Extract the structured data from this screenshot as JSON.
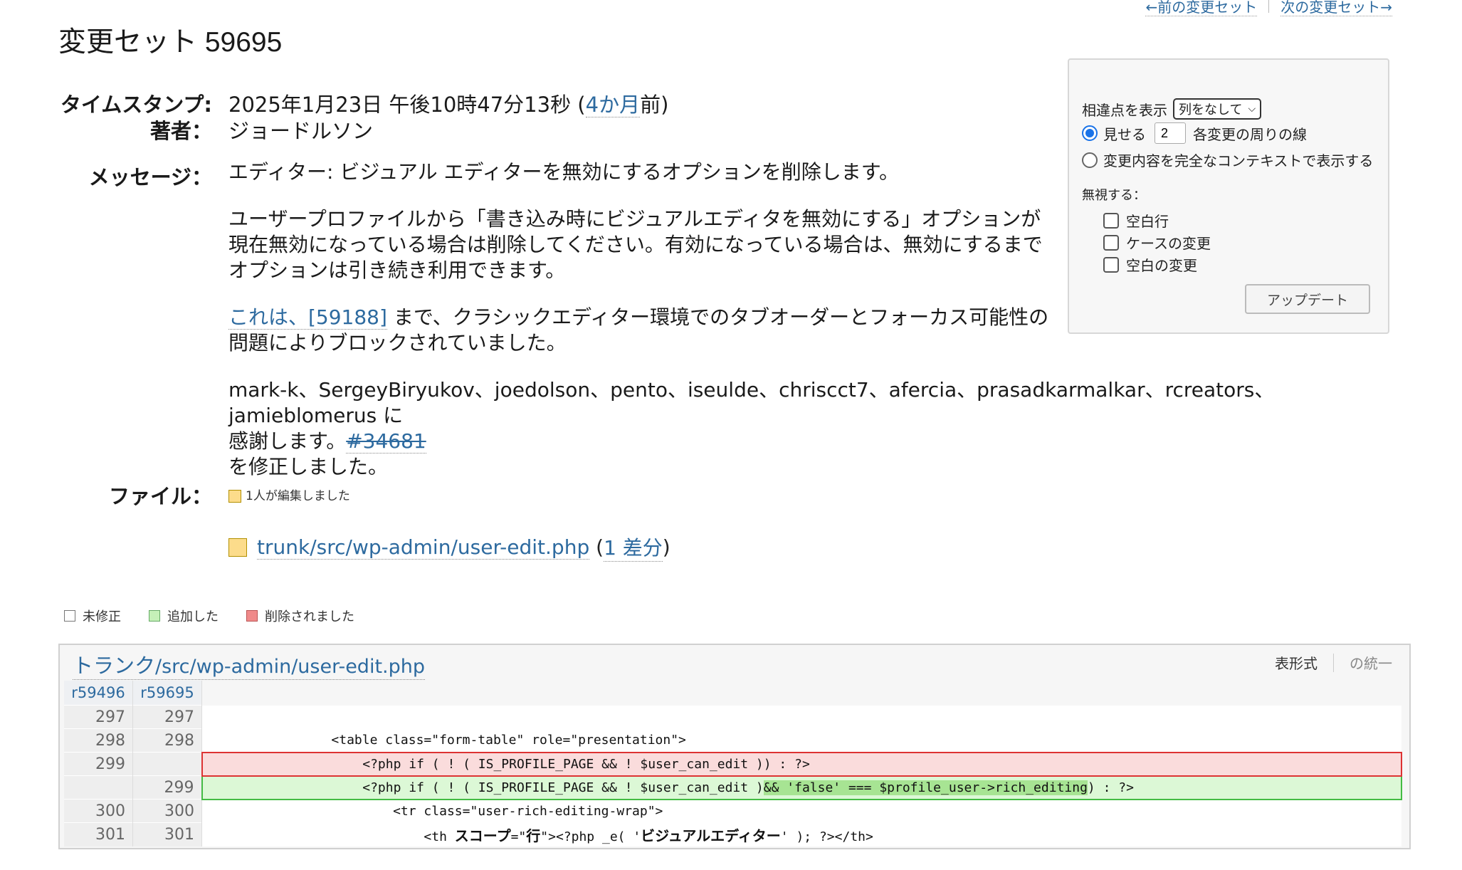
{
  "nav": {
    "prev": "←前の変更セット",
    "next": "次の変更セット→"
  },
  "title": "変更セット 59695",
  "props": {
    "timestamp_label": "タイムスタンプ:",
    "timestamp_value": "2025年1月23日 午後10時47分13秒 (",
    "timestamp_link": "4か月",
    "timestamp_suffix": "前)",
    "author_label": "著者：",
    "author_value": "ジョードルソン",
    "message_label": "メッセージ：",
    "files_label": "ファイル："
  },
  "message": {
    "p1": "エディター: ビジュアル エディターを無効にするオプションを削除します。",
    "p2_l1": "ユーザープロファイルから「書き込み時にビジュアルエディタを無効にする」オプションが",
    "p2_l2": "現在無効になっている場合は削除してください。有効になっている場合は、無効にするまで",
    "p2_l3": "オプションは引き続き利用できます。",
    "p3_link1": "これは、[59188]",
    "p3_text1": " まで、クラシックエディター環境でのタブオーダーとフォーカス可能性の",
    "p3_l2": "問題によりブロックされていました。",
    "p4_l1": "mark-k、SergeyBiryukov、joedolson、pento、iseulde、chrisсct7、afercia、prasadkarmalkar、rcreators、jamieblomerus に",
    "p4_l2a": "感謝します。",
    "p4_ticket": "#34681",
    "p4_l3": "を修正しました。"
  },
  "files": {
    "legend_edited": "1人が編集しました",
    "file_link": "trunk/src/wp-admin/user-edit.php",
    "open_paren": " (",
    "diff_link": "1 差分",
    "close_paren": ")"
  },
  "diff_options": {
    "show_diff_label": "相違点を表示",
    "show_diff_select": "列をなして",
    "show_label": "見せる",
    "lines_value": "2",
    "lines_suffix": "各変更の周りの線",
    "full_context": "変更内容を完全なコンテキストで表示する",
    "ignore_label": "無視する：",
    "ignore_blank": "空白行",
    "ignore_case": "ケースの変更",
    "ignore_whitespace": "空白の変更",
    "update_button": "アップデート"
  },
  "legend": {
    "unmodified": "未修正",
    "added": "追加した",
    "removed": "削除されました"
  },
  "diff": {
    "path_trunk": "トランク",
    "path_rest": "/src/wp-admin/user-edit.php",
    "view_tabular": "表形式",
    "view_unified": "の統一",
    "rev_old": "r59496",
    "rev_new": "r59695",
    "rows": [
      {
        "old": "297",
        "new": "297",
        "code": ""
      },
      {
        "old": "298",
        "new": "298",
        "code": "                <table class=\"form-table\" role=\"presentation\">"
      },
      {
        "old": "299",
        "new": "",
        "code": "                    <?php if ( ! ( IS_PROFILE_PAGE && ! $user_can_edit )) : ?>"
      },
      {
        "old": "",
        "new": "299",
        "code_pre": "                    <?php if ( ! ( IS_PROFILE_PAGE && ! $user_can_edit )",
        "code_hl": "&& 'false' === $profile_user->rich_editing",
        "code_post": ") : ?>"
      },
      {
        "old": "300",
        "new": "300",
        "code": "                        <tr class=\"user-rich-editing-wrap\">"
      },
      {
        "old": "301",
        "new": "301",
        "code_pre": "                            <th ",
        "code_jp1": "スコープ",
        "code_mid": "=\"",
        "code_jp2": "行",
        "code_mid2": "\"><?php _e( '",
        "code_jp3": "ビジュアルエディター",
        "code_post": "' ); ?></th>"
      }
    ]
  },
  "colors": {
    "link": "#2d6a9f",
    "modified": "#fcdc8b",
    "added": "#c5f0b8",
    "removed": "#f08a8a"
  }
}
